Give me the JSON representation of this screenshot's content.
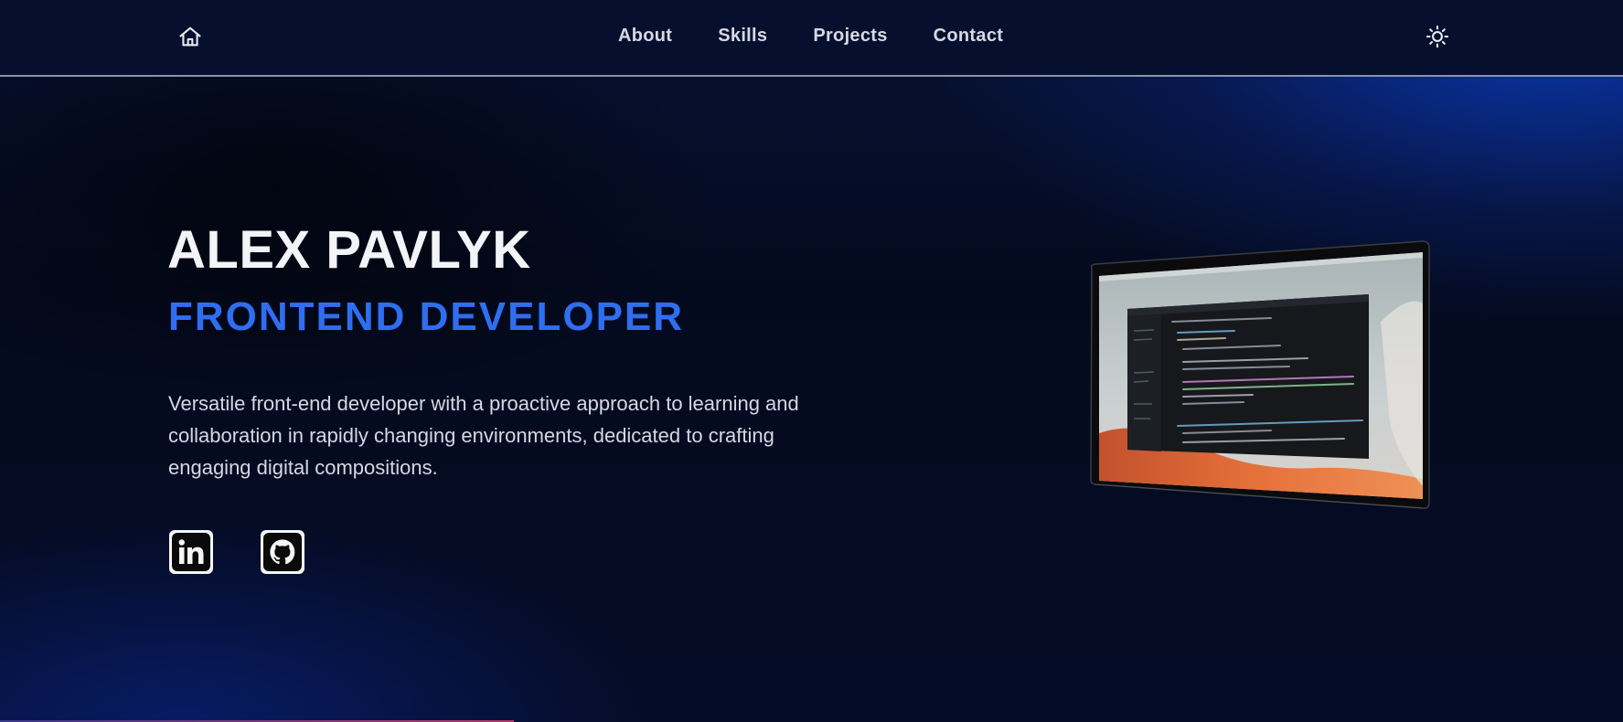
{
  "nav": {
    "home_icon": "home-icon",
    "links": [
      {
        "label": "About"
      },
      {
        "label": "Skills"
      },
      {
        "label": "Projects"
      },
      {
        "label": "Contact"
      }
    ],
    "theme_icon": "sun-icon"
  },
  "hero": {
    "name": "ALEX PAVLYK",
    "role": "FRONTEND DEVELOPER",
    "description": "Versatile front-end developer with a proactive approach to learning and collaboration in rapidly changing environments, dedicated to crafting engaging digital compositions.",
    "social": [
      {
        "icon": "linkedin-icon"
      },
      {
        "icon": "github-icon"
      }
    ]
  },
  "colors": {
    "accent": "#2f6ef0",
    "nav_bg": "#06102e",
    "page_bg": "#050a1c",
    "glow": "#0a3cbe"
  }
}
